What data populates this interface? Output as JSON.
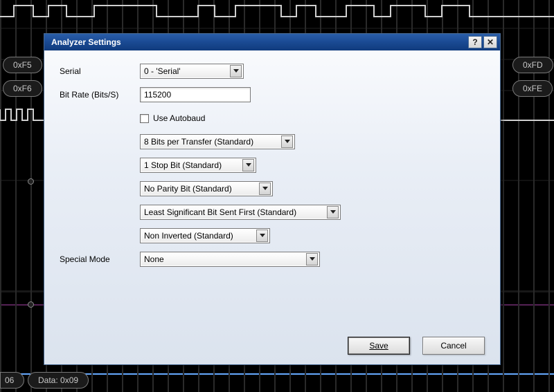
{
  "background": {
    "pills": {
      "p1": "0xF5",
      "p2": "0xF6",
      "p3": "0xFD",
      "p4": "0xFE",
      "p5": "06",
      "p6": "Data: 0x09"
    }
  },
  "dialog": {
    "title": "Analyzer Settings",
    "labels": {
      "serial": "Serial",
      "bitrate": "Bit Rate (Bits/S)",
      "special": "Special Mode"
    },
    "serial_value": "0 - 'Serial'",
    "bitrate_value": "115200",
    "autobaud": {
      "checked": false,
      "label": "Use Autobaud"
    },
    "bits_per_transfer": "8 Bits per Transfer (Standard)",
    "stop_bits": "1 Stop Bit (Standard)",
    "parity": "No Parity Bit (Standard)",
    "bit_order": "Least Significant Bit Sent First (Standard)",
    "inversion": "Non Inverted (Standard)",
    "special_mode": "None",
    "buttons": {
      "save": "Save",
      "cancel": "Cancel"
    }
  }
}
